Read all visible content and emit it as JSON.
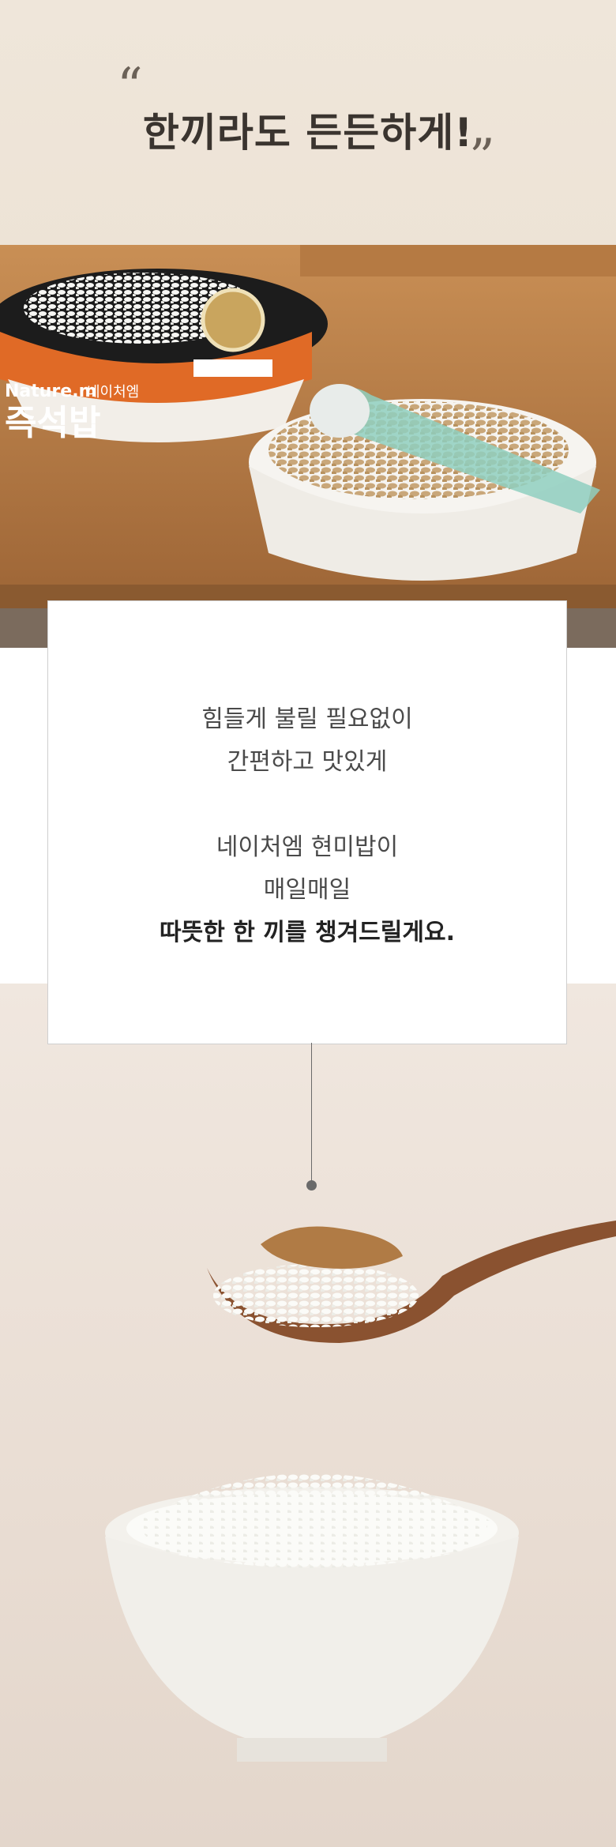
{
  "headline": "한끼라도 든든하게!",
  "quote_open": "“",
  "quote_close": "”",
  "lines": [
    "힘들게 불릴 필요없이",
    "간편하고 맛있게",
    "네이처엠 현미밥이",
    "매일매일",
    "따뜻한 한 끼를 챙겨드릴게요."
  ],
  "product": {
    "brand_en": "Nature.m",
    "brand_ko": "네이처엠",
    "name": "즉석밥"
  }
}
